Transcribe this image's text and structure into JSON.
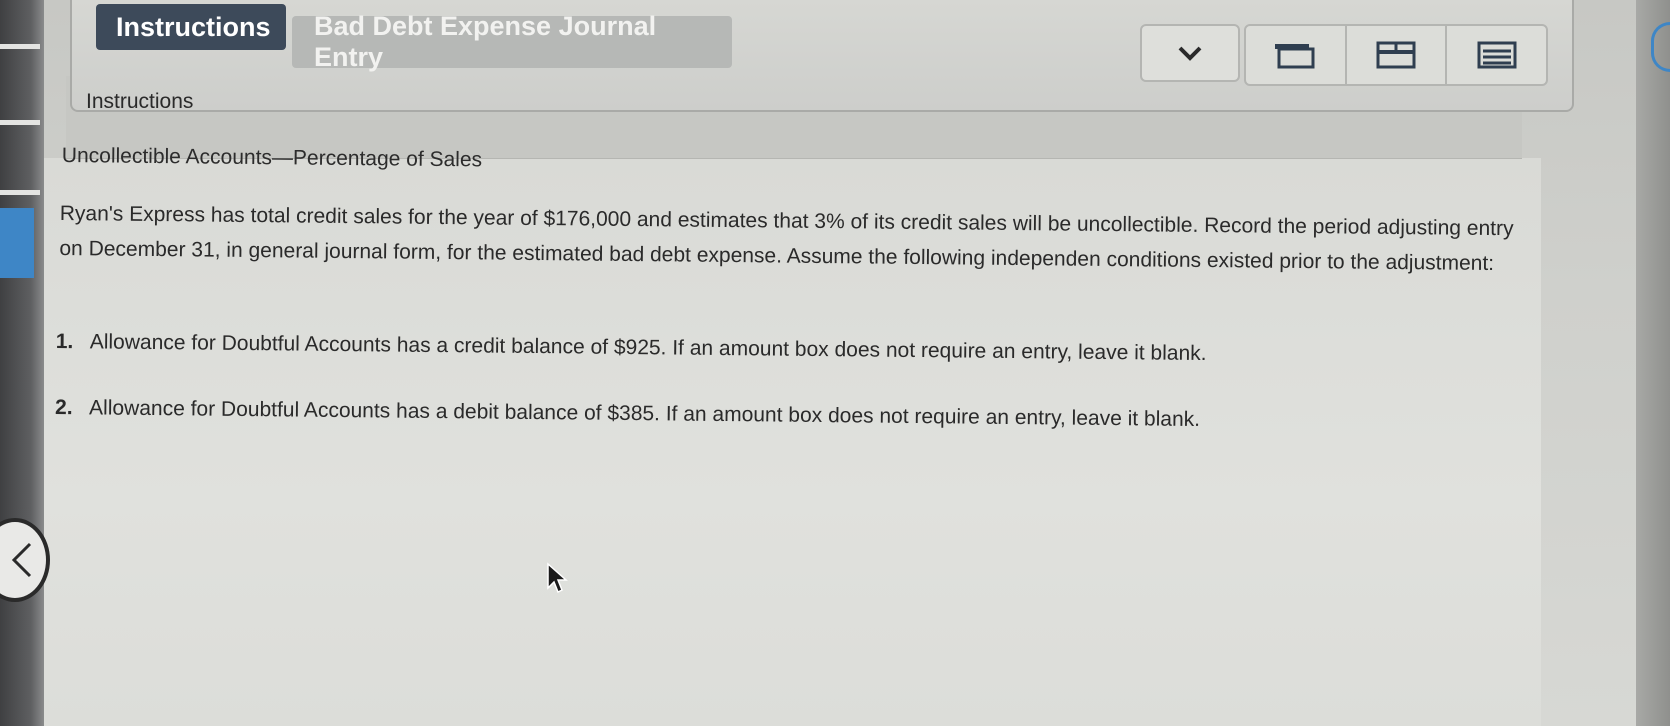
{
  "tabs": {
    "instructions": "Instructions",
    "journal": "Bad Debt Expense Journal Entry"
  },
  "toolbar": {
    "dropdown_icon": "chevron-down-icon",
    "view_icons": [
      "single-panel-icon",
      "split-panel-icon",
      "list-panel-icon"
    ]
  },
  "panel": {
    "title": "Instructions",
    "heading": "Uncollectible Accounts—Percentage of Sales",
    "paragraph": "Ryan's Express has total credit sales for the year of $176,000 and estimates that 3% of its credit sales will be uncollectible. Record the period adjusting entry on December 31, in general journal form, for the estimated bad debt expense. Assume the following independen conditions existed prior to the adjustment:",
    "items": [
      {
        "num": "1.",
        "text": "Allowance for Doubtful Accounts has a credit balance of $925. If an amount box does not require an entry, leave it blank."
      },
      {
        "num": "2.",
        "text": "Allowance for Doubtful Accounts has a debit balance of $385. If an amount box does not require an entry, leave it blank."
      }
    ]
  },
  "colors": {
    "active_tab": "#3d4a5a",
    "inactive_tab": "#b6b8b6",
    "accent": "#3e86c6"
  }
}
